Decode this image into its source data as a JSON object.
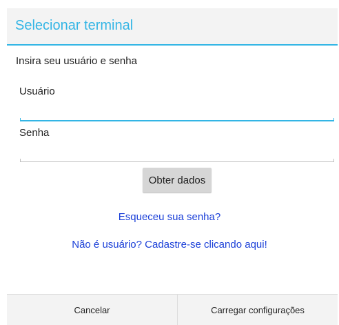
{
  "dialog": {
    "title": "Selecionar terminal",
    "prompt": "Insira seu usuário e senha"
  },
  "fields": {
    "username": {
      "label": "Usuário",
      "value": ""
    },
    "password": {
      "label": "Senha",
      "value": ""
    }
  },
  "actions": {
    "fetch_data_label": "Obter dados",
    "forgot_password_link": "Esqueceu sua senha?",
    "register_link": "Não é usuário? Cadastre-se clicando aqui!"
  },
  "footer": {
    "cancel_label": "Cancelar",
    "load_config_label": "Carregar configurações"
  },
  "colors": {
    "accent": "#33b5e5",
    "link": "#1a3fd8"
  }
}
